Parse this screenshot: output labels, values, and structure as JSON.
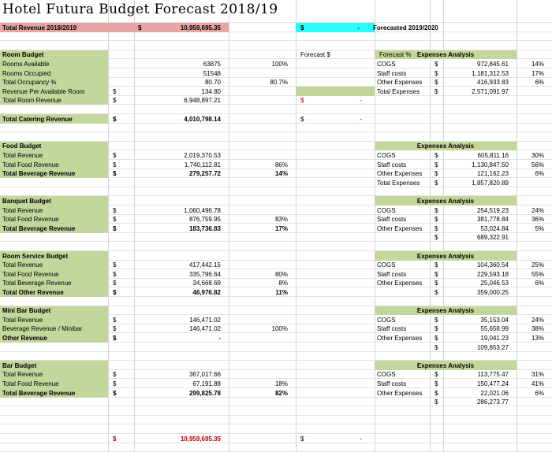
{
  "document": {
    "title": "Hotel Futura Budget Forecast 2018/19",
    "type": "spreadsheet"
  },
  "colors": {
    "section_header": "#c3d69b",
    "total_revenue_highlight": "#e6a5a0",
    "forecast_highlight": "#2afcfc",
    "negative_red": "#c00000",
    "grid_line": "#d4d4d4"
  },
  "top_summary": {
    "total_revenue_label": "Total Revenue 2018/2019",
    "total_revenue_currency": "$",
    "total_revenue_value": "10,959,695.35",
    "forecast_currency": "$",
    "forecast_value": "-",
    "forecast_label": "Forecasted 2019/2020"
  },
  "column_headers": {
    "forecast_dollar": "Forecast $",
    "forecast_percent": "Forecast %"
  },
  "expenses_analysis_title": "Expenses Analysis",
  "currency_symbol": "$",
  "budgets": [
    {
      "name": "Room Budget",
      "rows": [
        {
          "label": "Rooms Available",
          "currency": "",
          "value": "63875",
          "percent": "100%"
        },
        {
          "label": "Rooms Occupied",
          "currency": "",
          "value": "51548",
          "percent": ""
        },
        {
          "label": "Total Occupancy %",
          "currency": "",
          "value": "80.70",
          "percent": "80.7%"
        },
        {
          "label": "Revenue Per Available Room",
          "currency": "$",
          "value": "134.80",
          "percent": "",
          "forecast_highlight": true
        },
        {
          "label": "Total Room Revenue",
          "currency": "$",
          "value": "6,948,897.21",
          "percent": "",
          "forecast_currency": "$",
          "forecast_value": "-",
          "forecast_red": true
        }
      ],
      "expenses": [
        {
          "label": "COGS",
          "currency": "$",
          "value": "972,845.61",
          "percent": "14%"
        },
        {
          "label": "Staff costs",
          "currency": "$",
          "value": "1,181,312.53",
          "percent": "17%"
        },
        {
          "label": "Other Expenses",
          "currency": "$",
          "value": "416,933.83",
          "percent": "6%"
        },
        {
          "label": "Total Expenses",
          "currency": "$",
          "value": "2,571,091.97",
          "percent": ""
        }
      ]
    },
    {
      "name": "Total Catering Revenue",
      "standalone": true,
      "currency": "$",
      "value": "4,010,798.14",
      "forecast_currency": "$",
      "forecast_value": "-"
    },
    {
      "name": "Food Budget",
      "rows": [
        {
          "label": "Total Revenue",
          "currency": "$",
          "value": "2,019,370.53",
          "percent": ""
        },
        {
          "label": "Total Food Revenue",
          "currency": "$",
          "value": "1,740,112.81",
          "percent": "86%"
        },
        {
          "label": "Total Beverage Revenue",
          "currency": "$",
          "value": "279,257.72",
          "percent": "14%"
        }
      ],
      "expenses": [
        {
          "label": "COGS",
          "currency": "$",
          "value": "605,811.16",
          "percent": "30%"
        },
        {
          "label": "Staff costs",
          "currency": "$",
          "value": "1,130,847.50",
          "percent": "56%"
        },
        {
          "label": "Other Expenses",
          "currency": "$",
          "value": "121,162.23",
          "percent": "6%"
        },
        {
          "label": "Total Expenses",
          "currency": "$",
          "value": "1,857,820.89",
          "percent": ""
        }
      ]
    },
    {
      "name": "Banquet Budget",
      "rows": [
        {
          "label": "Total Revenue",
          "currency": "$",
          "value": "1,060,496.78",
          "percent": ""
        },
        {
          "label": "Total Food Revenue",
          "currency": "$",
          "value": "876,759.95",
          "percent": "83%"
        },
        {
          "label": "Total Beverage Revenue",
          "currency": "$",
          "value": "183,736.83",
          "percent": "17%"
        }
      ],
      "expenses": [
        {
          "label": "COGS",
          "currency": "$",
          "value": "254,519.23",
          "percent": "24%"
        },
        {
          "label": "Staff costs",
          "currency": "$",
          "value": "381,778.84",
          "percent": "36%"
        },
        {
          "label": "Other Expenses",
          "currency": "$",
          "value": "53,024.84",
          "percent": "5%"
        },
        {
          "label": "",
          "currency": "$",
          "value": "689,322.91",
          "percent": ""
        }
      ]
    },
    {
      "name": "Room Service Budget",
      "rows": [
        {
          "label": "Total Revenue",
          "currency": "$",
          "value": "417,442.15",
          "percent": ""
        },
        {
          "label": "Total Food Revenue",
          "currency": "$",
          "value": "335,796.64",
          "percent": "80%"
        },
        {
          "label": "Total Beverage Revenue",
          "currency": "$",
          "value": "34,668.69",
          "percent": "8%"
        },
        {
          "label": "Total Other Revenue",
          "currency": "$",
          "value": "46,976.82",
          "percent": "11%"
        }
      ],
      "expenses": [
        {
          "label": "COGS",
          "currency": "$",
          "value": "104,360.54",
          "percent": "25%"
        },
        {
          "label": "Staff costs",
          "currency": "$",
          "value": "229,593.18",
          "percent": "55%"
        },
        {
          "label": "Other Expenses",
          "currency": "$",
          "value": "25,046.53",
          "percent": "6%"
        },
        {
          "label": "",
          "currency": "$",
          "value": "359,000.25",
          "percent": ""
        }
      ]
    },
    {
      "name": "Mini Bar Budget",
      "rows": [
        {
          "label": "Total Revenue",
          "currency": "$",
          "value": "146,471.02",
          "percent": ""
        },
        {
          "label": "Beverage Revenue / Minibar",
          "currency": "$",
          "value": "146,471.02",
          "percent": "100%"
        },
        {
          "label": "Other Revenue",
          "currency": "$",
          "value": "-",
          "percent": ""
        }
      ],
      "expenses": [
        {
          "label": "COGS",
          "currency": "$",
          "value": "35,153.04",
          "percent": "24%"
        },
        {
          "label": "Staff costs",
          "currency": "$",
          "value": "55,658.99",
          "percent": "38%"
        },
        {
          "label": "Other Expenses",
          "currency": "$",
          "value": "19,041.23",
          "percent": "13%"
        },
        {
          "label": "",
          "currency": "$",
          "value": "109,853.27",
          "percent": ""
        }
      ]
    },
    {
      "name": "Bar Budget",
      "rows": [
        {
          "label": "Total Revenue",
          "currency": "$",
          "value": "367,017.66",
          "percent": ""
        },
        {
          "label": "Total Food Revenue",
          "currency": "$",
          "value": "67,191.88",
          "percent": "18%"
        },
        {
          "label": "Total Beverage Revenue",
          "currency": "$",
          "value": "299,825.78",
          "percent": "82%"
        }
      ],
      "expenses": [
        {
          "label": "COGS",
          "currency": "$",
          "value": "113,775.47",
          "percent": "31%"
        },
        {
          "label": "Staff costs",
          "currency": "$",
          "value": "150,477.24",
          "percent": "41%"
        },
        {
          "label": "Other Expenses",
          "currency": "$",
          "value": "22,021.06",
          "percent": "6%"
        },
        {
          "label": "",
          "currency": "$",
          "value": "286,273.77",
          "percent": ""
        }
      ]
    }
  ],
  "grand_total": {
    "currency": "$",
    "value": "10,959,695.35",
    "forecast_currency": "$",
    "forecast_value": "-"
  }
}
